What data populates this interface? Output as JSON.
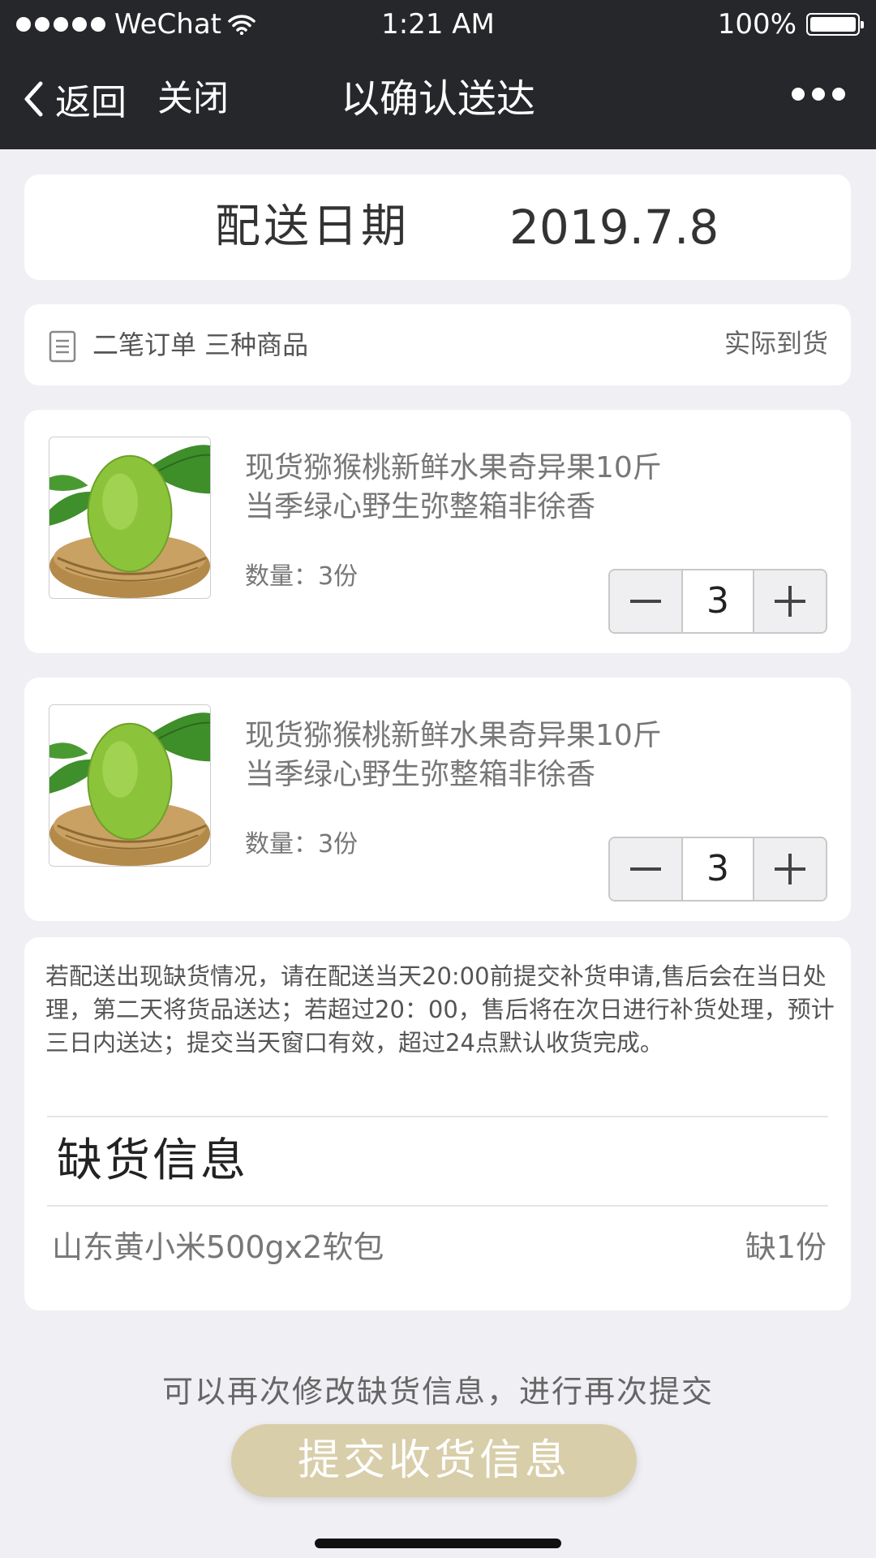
{
  "status_bar": {
    "carrier": "WeChat",
    "time": "1:21 AM",
    "battery": "100%"
  },
  "nav": {
    "back_label": "返回",
    "close_label": "关闭",
    "title": "以确认送达"
  },
  "delivery": {
    "label": "配送日期",
    "date": "2019.7.8"
  },
  "summary": {
    "orders_text": "二笔订单 三种商品",
    "arrival_label": "实际到货"
  },
  "products": [
    {
      "name_line1": "现货猕猴桃新鲜水果奇异果10斤",
      "name_line2": "当季绿心野生弥整箱非徐香",
      "quantity_text": "数量：3份",
      "stepper_value": "3"
    },
    {
      "name_line1": "现货猕猴桃新鲜水果奇异果10斤",
      "name_line2": "当季绿心野生弥整箱非徐香",
      "quantity_text": "数量：3份",
      "stepper_value": "3"
    }
  ],
  "notice": "若配送出现缺货情况，请在配送当天20:00前提交补货申请,售后会在当日处理，第二天将货品送达；若超过20：00，售后将在次日进行补货处理，预计三日内送达；提交当天窗口有效，超过24点默认收货完成。",
  "shortage": {
    "title": "缺货信息",
    "item_name": "山东黄小米500gx2软包",
    "item_qty": "缺1份"
  },
  "hint": "可以再次修改缺货信息，进行再次提交",
  "submit_label": "提交收货信息",
  "colors": {
    "header_bg": "#26272b",
    "page_bg": "#efeff4",
    "submit_bg": "#d9ceaa"
  },
  "icons": [
    "signal-dots-icon",
    "wifi-icon",
    "battery-icon",
    "chevron-left-icon",
    "more-dots-icon",
    "document-icon",
    "kiwi-product-image",
    "minus-icon",
    "plus-icon"
  ]
}
